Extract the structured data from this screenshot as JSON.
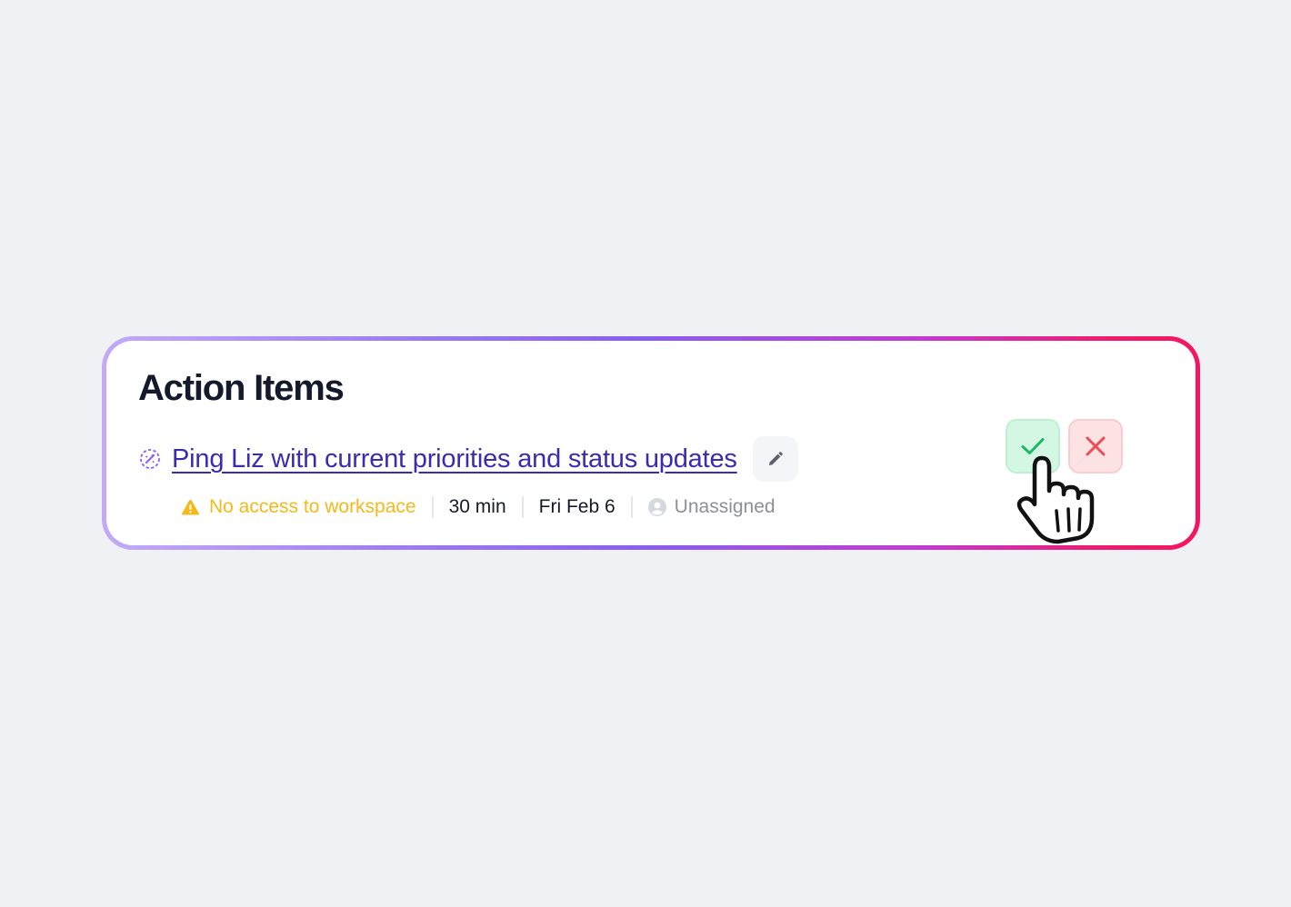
{
  "panel": {
    "title": "Action Items"
  },
  "task": {
    "title": "Ping Liz with current priorities and status updates",
    "icon": "ai-sparkle-icon",
    "edit_icon": "pencil-icon",
    "meta": {
      "warning": "No access to workspace",
      "warning_icon": "warning-triangle-icon",
      "duration": "30 min",
      "due_date": "Fri Feb 6",
      "assignee": "Unassigned",
      "assignee_icon": "user-avatar-icon"
    },
    "accept_icon": "check-icon",
    "reject_icon": "close-icon"
  },
  "colors": {
    "link": "#3a2bb3",
    "warning": "#f4b91a",
    "accept_bg": "#d3f7e2",
    "accept_fg": "#1bb866",
    "reject_bg": "#fde2e3",
    "reject_fg": "#ee4b52",
    "border_gradient_start": "#c3aaf7",
    "border_gradient_end": "#f5155f"
  }
}
